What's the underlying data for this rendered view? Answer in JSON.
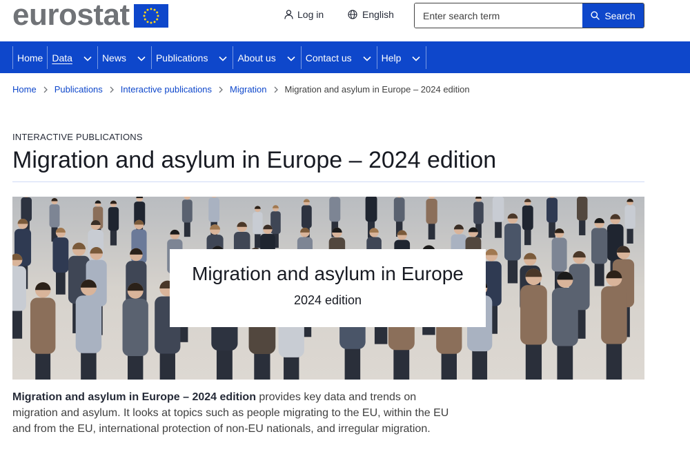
{
  "header": {
    "logo_text": "eurostat",
    "login_label": "Log in",
    "language_label": "English",
    "search_placeholder": "Enter search term",
    "search_button": "Search"
  },
  "nav": {
    "items": [
      {
        "label": "Home",
        "dropdown": false
      },
      {
        "label": "Data",
        "dropdown": true,
        "active": true
      },
      {
        "label": "News",
        "dropdown": true
      },
      {
        "label": "Publications",
        "dropdown": true
      },
      {
        "label": "About us",
        "dropdown": true
      },
      {
        "label": "Contact us",
        "dropdown": true
      },
      {
        "label": "Help",
        "dropdown": true
      }
    ]
  },
  "breadcrumb": {
    "items": [
      "Home",
      "Publications",
      "Interactive publications",
      "Migration"
    ],
    "current": "Migration and asylum in Europe – 2024 edition"
  },
  "page": {
    "kicker": "INTERACTIVE PUBLICATIONS",
    "title": "Migration and asylum in Europe – 2024 edition"
  },
  "banner": {
    "title": "Migration and asylum in Europe",
    "subtitle": "2024 edition"
  },
  "intro": {
    "lead": "Migration and asylum in Europe – 2024 edition",
    "text": " provides key data and trends on migration and asylum. It looks at topics such as people migrating to the EU, within the EU and from the EU, international protection of non-EU nationals, and irregular migration."
  },
  "colors": {
    "brand_blue": "#0e47cb",
    "logo_grey": "#707377",
    "flag_star": "#ffd617"
  }
}
